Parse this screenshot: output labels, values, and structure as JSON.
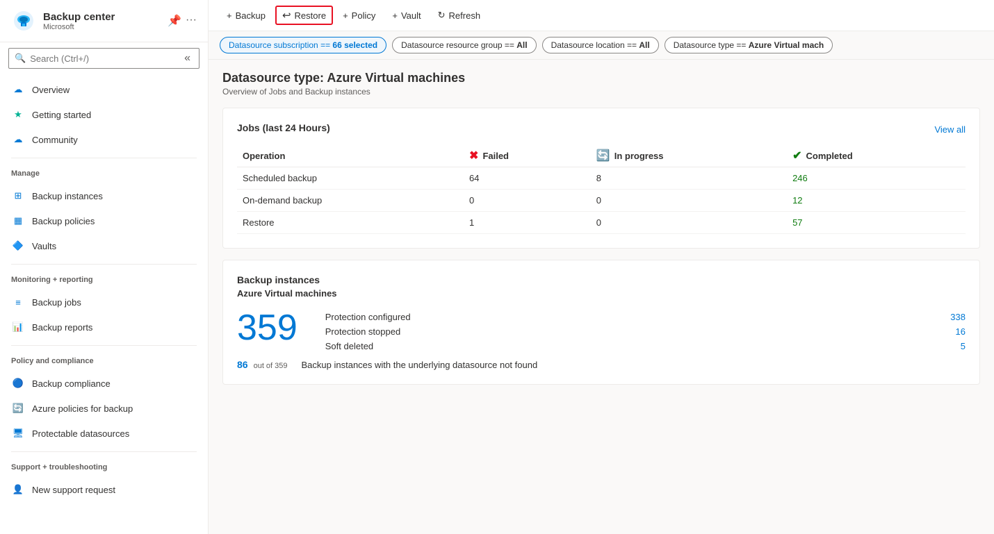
{
  "app": {
    "title": "Backup center",
    "subtitle": "Microsoft",
    "pin_icon": "📌",
    "more_icon": "..."
  },
  "search": {
    "placeholder": "Search (Ctrl+/)"
  },
  "sidebar": {
    "nav_items": [
      {
        "id": "overview",
        "label": "Overview",
        "icon": "cloud",
        "active": false,
        "section": "main"
      },
      {
        "id": "getting-started",
        "label": "Getting started",
        "icon": "star",
        "active": false,
        "section": "main"
      },
      {
        "id": "community",
        "label": "Community",
        "icon": "cloud-comm",
        "active": false,
        "section": "main"
      },
      {
        "id": "manage-label",
        "label": "Manage",
        "type": "group-label"
      },
      {
        "id": "backup-instances",
        "label": "Backup instances",
        "icon": "grid",
        "active": false,
        "section": "manage"
      },
      {
        "id": "backup-policies",
        "label": "Backup policies",
        "icon": "policy",
        "active": false,
        "section": "manage"
      },
      {
        "id": "vaults",
        "label": "Vaults",
        "icon": "vault",
        "active": false,
        "section": "manage"
      },
      {
        "id": "monitoring-label",
        "label": "Monitoring + reporting",
        "type": "group-label"
      },
      {
        "id": "backup-jobs",
        "label": "Backup jobs",
        "icon": "jobs",
        "active": false,
        "section": "monitoring"
      },
      {
        "id": "backup-reports",
        "label": "Backup reports",
        "icon": "reports",
        "active": false,
        "section": "monitoring"
      },
      {
        "id": "policy-label",
        "label": "Policy and compliance",
        "type": "group-label"
      },
      {
        "id": "backup-compliance",
        "label": "Backup compliance",
        "icon": "compliance",
        "active": false,
        "section": "policy"
      },
      {
        "id": "azure-policies",
        "label": "Azure policies for backup",
        "icon": "azure-policy",
        "active": false,
        "section": "policy"
      },
      {
        "id": "protectable",
        "label": "Protectable datasources",
        "icon": "protectable",
        "active": false,
        "section": "policy"
      },
      {
        "id": "support-label",
        "label": "Support + troubleshooting",
        "type": "group-label"
      },
      {
        "id": "support-request",
        "label": "New support request",
        "icon": "support",
        "active": false,
        "section": "support"
      }
    ]
  },
  "toolbar": {
    "backup_label": "+ Backup",
    "restore_label": "↩ Restore",
    "policy_label": "+ Policy",
    "vault_label": "+ Vault",
    "refresh_label": "↻ Refresh"
  },
  "filters": [
    {
      "id": "subscription",
      "label": "Datasource subscription == ",
      "bold": "66 selected",
      "active": true
    },
    {
      "id": "resource-group",
      "label": "Datasource resource group == ",
      "bold": "All",
      "active": false
    },
    {
      "id": "location",
      "label": "Datasource location == ",
      "bold": "All",
      "active": false
    },
    {
      "id": "type",
      "label": "Datasource type == ",
      "bold": "Azure Virtual mach",
      "active": false
    }
  ],
  "page": {
    "title": "Datasource type: Azure Virtual machines",
    "subtitle": "Overview of Jobs and Backup instances"
  },
  "jobs_card": {
    "title": "Jobs (last 24 Hours)",
    "view_all": "View all",
    "columns": {
      "operation": "Operation",
      "failed": "Failed",
      "in_progress": "In progress",
      "completed": "Completed"
    },
    "rows": [
      {
        "operation": "Scheduled backup",
        "failed": "64",
        "in_progress": "8",
        "completed": "246"
      },
      {
        "operation": "On-demand backup",
        "failed": "0",
        "in_progress": "0",
        "completed": "12"
      },
      {
        "operation": "Restore",
        "failed": "1",
        "in_progress": "0",
        "completed": "57"
      }
    ]
  },
  "instances_card": {
    "title": "Backup instances",
    "subtitle": "Azure Virtual machines",
    "total": "359",
    "stats": [
      {
        "label": "Protection configured",
        "value": "338"
      },
      {
        "label": "Protection stopped",
        "value": "16"
      },
      {
        "label": "Soft deleted",
        "value": "5"
      }
    ],
    "footer_count": "86",
    "footer_sub": "out of 359",
    "footer_desc": "Backup instances with the underlying datasource not found"
  }
}
